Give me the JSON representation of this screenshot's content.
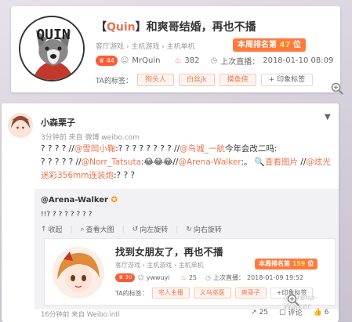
{
  "room": {
    "title_bracket_open": "【",
    "title_name": "Quin",
    "title_bracket_close": "】",
    "title_rest": "和爽哥结婚，再也不播",
    "crumbs": "客厅游戏 › 主机游戏 › 主机单机",
    "rank_label": "本周排名第",
    "rank_value": "47",
    "rank_suffix": "位",
    "level": "44",
    "host": "MrQuin",
    "fire_count": "382",
    "last_live_label": "上次直播：",
    "last_live_time": "2018-01-10 08:09",
    "tags_label": "TA的标签：",
    "tags": [
      "狗头人",
      "白丝jk",
      "摸鱼侠"
    ],
    "add_tag": "+ 印象标签",
    "avatar_text": "QUIN"
  },
  "post": {
    "user": "小森栗子",
    "time": "3分钟前 来自 微博 weibo.com",
    "line1_a": "? ? ? ? //",
    "line1_at1": "@雪岡小鞠",
    "line1_b": ":? ? ? ? ? ? ? ? //",
    "line1_at2": "@鸟城_一航",
    "line1_c": "今年会改二吗:",
    "line2_a": "? ? ? ? ? //",
    "line2_at1": "@Norr_Tatsuta",
    "line2_b": ":😂😂😂//",
    "line2_at2": "@Arena-Walker",
    "line2_c": ":。",
    "line2_link": "🔍查看图片",
    "line2_d": "  //",
    "line2_at3": "@炫光迷彩356mm连装炮",
    "line3": ":? ? ?",
    "repost": {
      "user": "@Arena-Walker",
      "text": "!!? ? ? ? ? ? ? ?",
      "tools": [
        "收起",
        "查看大图",
        "向左旋转",
        "向右旋转"
      ],
      "card": {
        "title": "找到女朋友了，再也不播",
        "crumbs": "客厅游戏 › 主机游戏 › 主机单机",
        "rank_label": "本周排名第",
        "rank_value": "159",
        "rank_suffix": "位",
        "level": "30",
        "host": "ywwuyi",
        "fire_count": "25",
        "last_live_label": "上次直播：",
        "last_live_time": "2018-01-09 19:52",
        "tags_label": "TA的标签：",
        "tags": [
          "宅人主播",
          "义乌巫医",
          "爽哥子"
        ],
        "add_tag": "+印象标签",
        "watermark": "@Arena-Walker"
      }
    },
    "source": "16分钟前 来自 Weibo.intl",
    "repost_count": "25",
    "comment_label": "评论",
    "like_count": "6"
  },
  "colors": {
    "accent": "#eb7350",
    "rank_bg": "#ff7a3d",
    "level_bg": "#ff5a33"
  }
}
